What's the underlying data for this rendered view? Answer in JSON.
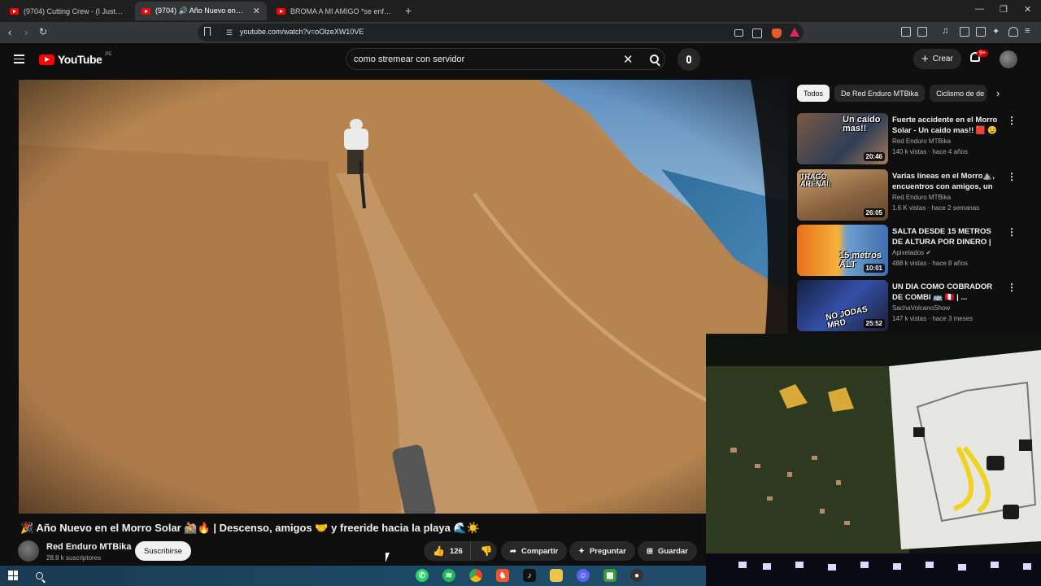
{
  "browser": {
    "tabs": [
      {
        "title": "(9704) Cutting Crew - (I Just) Died In",
        "active": false
      },
      {
        "title": "(9704) 🔊 Año Nuevo en el M",
        "active": true
      },
      {
        "title": "BROMA A MI AMIGO *se enfada mu",
        "active": false
      }
    ],
    "url": "youtube.com/watch?v=oOlzeXW10VE"
  },
  "masthead": {
    "logo_text": "YouTube",
    "country_code": "PE",
    "search_query": "como stremear con servidor",
    "create_label": "Crear",
    "notification_badge": "9+"
  },
  "video": {
    "title": "🎉 Año Nuevo en el Morro Solar 🚵🔥 | Descenso, amigos 🤝 y freeride hacia la playa 🌊☀️",
    "channel_name": "Red Enduro MTBika",
    "subscribers": "28.8 k suscriptores",
    "subscribe_label": "Suscribirse",
    "likes": "126",
    "share_label": "Compartir",
    "ask_label": "Preguntar",
    "save_label": "Guardar"
  },
  "sidebar": {
    "chips": [
      "Todos",
      "De Red Enduro MTBika",
      "Ciclismo de de"
    ],
    "recommendations": [
      {
        "title": "Fuerte accidente en el Morro Solar - Un caido mas!! 🟥 😉",
        "channel": "Red Enduro MTBika",
        "meta": "140 k vistas · hace 4 años",
        "duration": "20:46",
        "thumb_text": "Un caído mas!!"
      },
      {
        "title": "Varias líneas en el Morro⛰️, encuentros con amigos, un ...",
        "channel": "Red Enduro MTBika",
        "meta": "1.6 K vistas · hace 2 semanas",
        "duration": "26:05",
        "thumb_text": "TRAGÓ ARENA!!"
      },
      {
        "title": "SALTA DESDE 15 METROS DE ALTURA POR DINERO | PODRÍ...",
        "channel": "Apixelados",
        "meta": "488 k vistas · hace 8 años",
        "duration": "10:01",
        "thumb_text": "15 metros ALT"
      },
      {
        "title": "UN DIA COMO COBRADOR DE COMBI 🚌 🇵🇪 | ...",
        "channel": "SachaVolcanoShow",
        "meta": "147 k vistas · hace 3 meses",
        "duration": "25:52",
        "thumb_text": "NO JODAS MRD"
      }
    ]
  },
  "colors": {
    "accent": "#ff0000",
    "background": "#0f0f0f",
    "chip_active": "#f1f1f1"
  }
}
